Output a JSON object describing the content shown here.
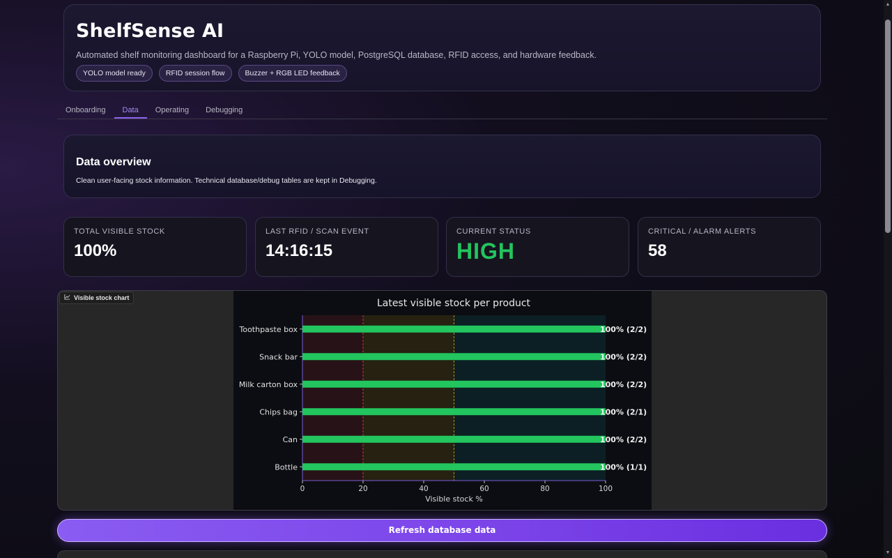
{
  "header": {
    "title": "ShelfSense AI",
    "subtitle": "Automated shelf monitoring dashboard for a Raspberry Pi, YOLO model, PostgreSQL database, RFID access, and hardware feedback.",
    "pills": [
      "YOLO model ready",
      "RFID session flow",
      "Buzzer + RGB LED feedback"
    ]
  },
  "tabs": [
    {
      "label": "Onboarding",
      "active": false
    },
    {
      "label": "Data",
      "active": true
    },
    {
      "label": "Operating",
      "active": false
    },
    {
      "label": "Debugging",
      "active": false
    }
  ],
  "overview": {
    "title": "Data overview",
    "description": "Clean user-facing stock information. Technical database/debug tables are kept in Debugging."
  },
  "stats": [
    {
      "label": "TOTAL VISIBLE STOCK",
      "value": "100%"
    },
    {
      "label": "LAST RFID / SCAN EVENT",
      "value": "14:16:15"
    },
    {
      "label": "CURRENT STATUS",
      "value": "HIGH",
      "color": "#23c45e"
    },
    {
      "label": "CRITICAL / ALARM ALERTS",
      "value": "58"
    }
  ],
  "chart_panel": {
    "tag_label": "Visible stock chart",
    "tag_icon": "line-chart-icon"
  },
  "chart_data": {
    "type": "bar",
    "orientation": "horizontal",
    "title": "Latest visible stock per product",
    "xlabel": "Visible stock %",
    "ylabel": "",
    "xlim": [
      0,
      100
    ],
    "xticks": [
      0,
      20,
      40,
      60,
      80,
      100
    ],
    "categories": [
      "Toothpaste box",
      "Snack bar",
      "Milk carton box",
      "Chips bag",
      "Can",
      "Bottle"
    ],
    "values": [
      100,
      100,
      100,
      100,
      100,
      100
    ],
    "data_labels": [
      "100% (2/2)",
      "100% (2/2)",
      "100% (2/2)",
      "100% (2/1)",
      "100% (2/2)",
      "100% (1/1)"
    ],
    "zones": [
      {
        "from": 0,
        "to": 20,
        "color": "#ef4444"
      },
      {
        "from": 20,
        "to": 50,
        "color": "#eab308"
      },
      {
        "from": 50,
        "to": 100,
        "color": "#0ea5b7"
      }
    ],
    "threshold_lines": [
      20,
      50
    ],
    "bar_color": "#22c55e",
    "grid": false
  },
  "actions": {
    "refresh_label": "Refresh database data"
  },
  "colors": {
    "accent": "#8b63f0",
    "status_high": "#23c45e",
    "bar": "#22c55e"
  }
}
